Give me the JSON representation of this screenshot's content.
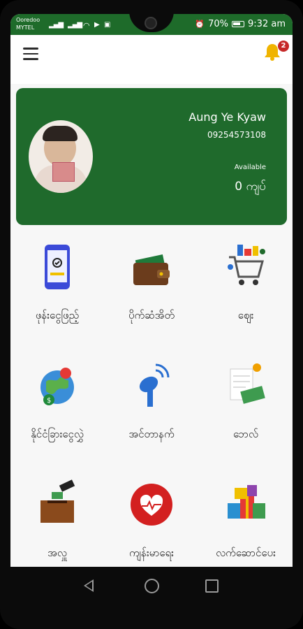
{
  "status_bar": {
    "carrier_1": "Ooredoo",
    "carrier_2": "MYTEL",
    "battery": "70%",
    "time": "9:32 am"
  },
  "app_bar": {
    "notification_count": "2"
  },
  "account_card": {
    "name": "Aung Ye Kyaw",
    "phone": "09254573108",
    "available_label": "Available",
    "balance": "0 ကျပ်"
  },
  "services": [
    {
      "label": "ဖုန်းငွေဖြည့်",
      "icon": "mobile-topup-icon"
    },
    {
      "label": "ပိုက်ဆံအိတ်",
      "icon": "wallet-icon"
    },
    {
      "label": "ဈေး",
      "icon": "shopping-cart-icon"
    },
    {
      "label": "နိုင်ငံခြားငွေလွှဲ",
      "icon": "globe-money-icon"
    },
    {
      "label": "အင်တာနက်",
      "icon": "wifi-antenna-icon"
    },
    {
      "label": "ဘေလ်",
      "icon": "bill-icon"
    },
    {
      "label": "အလှူ",
      "icon": "donation-box-icon"
    },
    {
      "label": "ကျန်းမာရေး",
      "icon": "heart-health-icon"
    },
    {
      "label": "လက်ဆောင်ပေး",
      "icon": "gift-boxes-icon"
    }
  ],
  "colors": {
    "primary_green": "#1f6a2c",
    "bell_yellow": "#f0b400",
    "badge_red": "#c62828"
  }
}
